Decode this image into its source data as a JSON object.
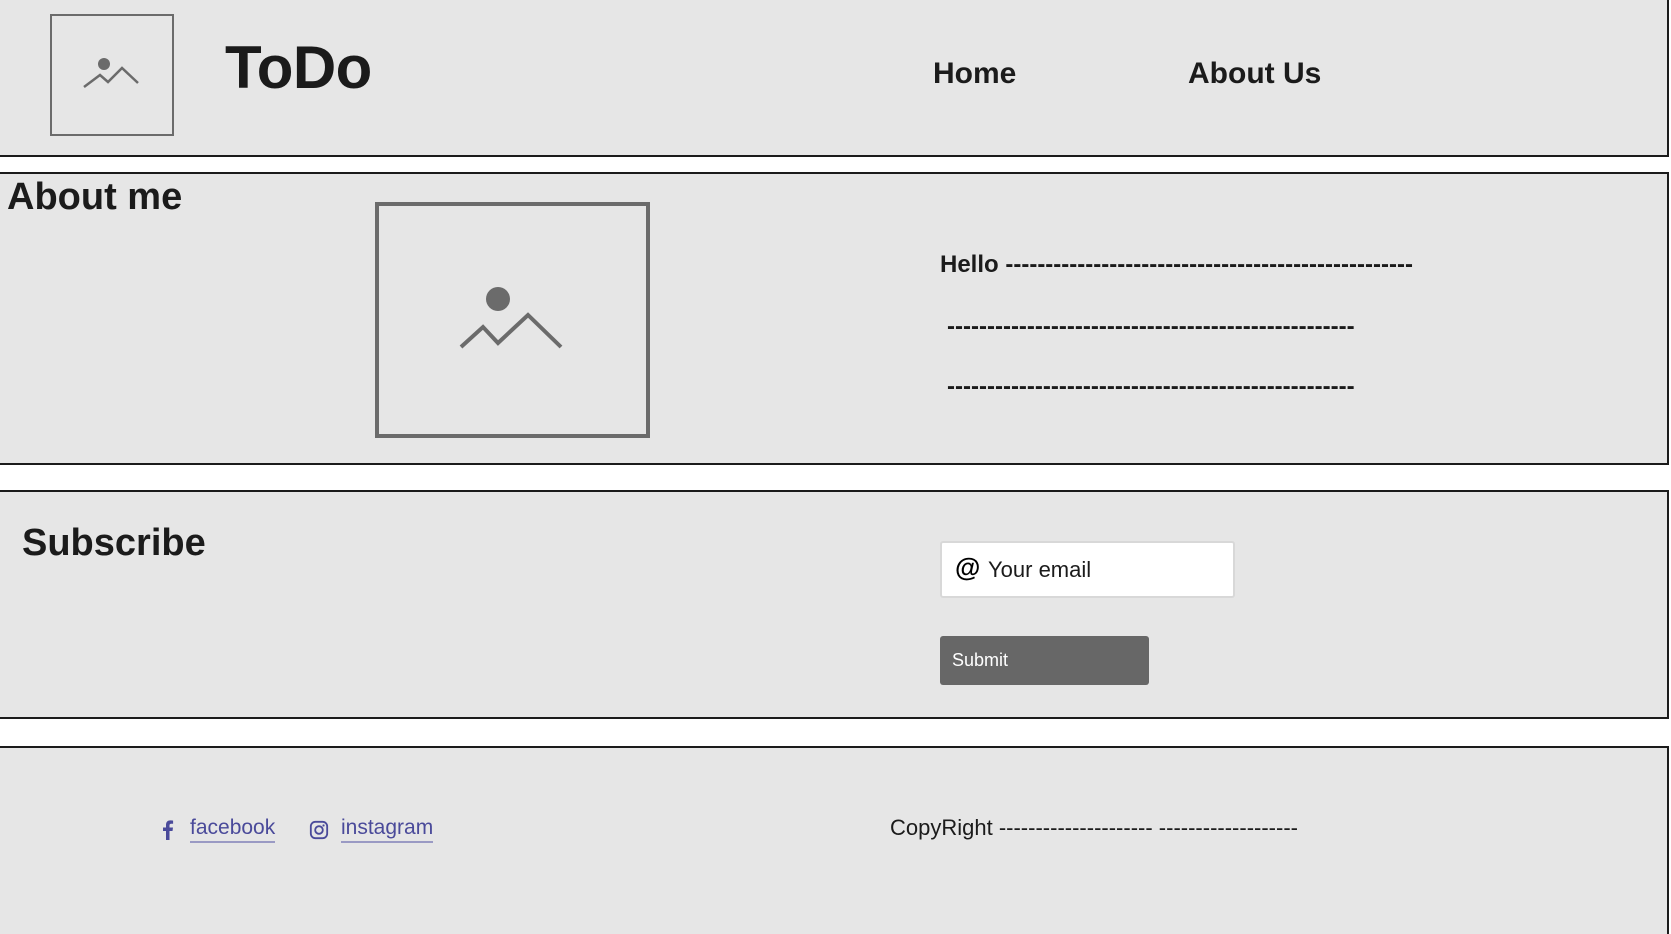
{
  "header": {
    "title": "ToDo",
    "nav": [
      {
        "label": "Home"
      },
      {
        "label": "About Us"
      }
    ]
  },
  "about": {
    "title": "About me",
    "lines": [
      "Hello ---------------------------------------------------",
      "---------------------------------------------------",
      "---------------------------------------------------"
    ]
  },
  "subscribe": {
    "title": "Subscribe",
    "email_icon": "@",
    "email_placeholder": "Your email",
    "email_value": "",
    "submit_label": "Submit"
  },
  "footer": {
    "social": [
      {
        "label": "facebook",
        "icon": "facebook-icon"
      },
      {
        "label": "instagram",
        "icon": "instagram-icon"
      }
    ],
    "copyright": "CopyRight --------------------- -------------------"
  },
  "colors": {
    "background": "#e6e6e6",
    "border": "#1b1b1b",
    "button": "#676767",
    "link": "#4a4a9a"
  }
}
